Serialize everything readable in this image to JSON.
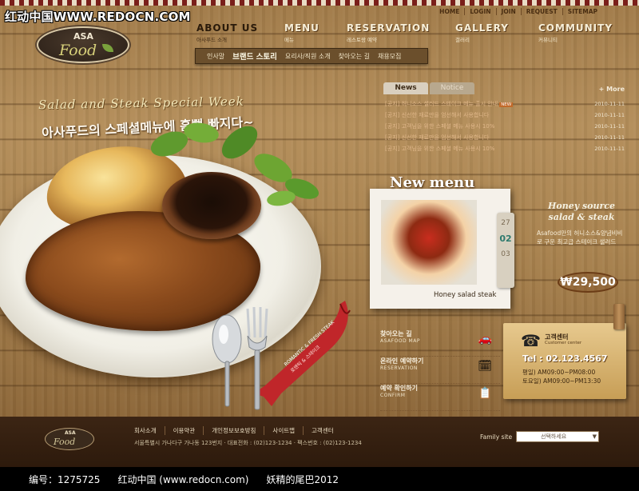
{
  "watermark": {
    "text": "红动中国WWW.REDOCN.COM"
  },
  "util_nav": [
    "HOME",
    "LOGIN",
    "JOIN",
    "REQUEST",
    "SITEMAP"
  ],
  "logo": {
    "top": "ASA",
    "main": "Food"
  },
  "nav": [
    {
      "label": "ABOUT US",
      "sub": "아사푸드 소개"
    },
    {
      "label": "MENU",
      "sub": "메뉴"
    },
    {
      "label": "RESERVATION",
      "sub": "레스토랑 예약"
    },
    {
      "label": "GALLERY",
      "sub": "갤러리"
    },
    {
      "label": "COMMUNITY",
      "sub": "커뮤니티"
    }
  ],
  "subnav": [
    "인사말",
    "브랜드 스토리",
    "요리사/직원 소개",
    "찾아오는 길",
    "채용모집"
  ],
  "hero": {
    "line1": "Salad and Steak Special Week",
    "line2": "아사푸드의 스페셜메뉴에 흠뻑 빠지다~"
  },
  "news": {
    "tab_news": "News",
    "tab_notice": "Notice",
    "more": "+ More",
    "items": [
      {
        "title": "[공지] 허니소스 샐러드 스테이크 메뉴 출시 안내",
        "date": "2010-11-11",
        "badge": "NEW"
      },
      {
        "title": "[공지] 신선한 재료만을 엄선해서 사용합니다",
        "date": "2010-11-11",
        "badge": ""
      },
      {
        "title": "[공지] 고객님을 위한 스페셜 메뉴 사용시 10%",
        "date": "2010-11-11",
        "badge": ""
      },
      {
        "title": "[공지] 신선한 재료만을 엄선해서 사용합니다",
        "date": "2010-11-11",
        "badge": ""
      },
      {
        "title": "[공지] 고객님을 위한 스페셜 메뉴 사용시 10%",
        "date": "2010-11-11",
        "badge": ""
      }
    ]
  },
  "new_menu": {
    "title": "New menu",
    "caption": "Honey salad steak",
    "tag": [
      "27",
      "02",
      "03"
    ],
    "name1": "Honey source",
    "name2": "salad & steak",
    "desc": "Asafood만의 허니소스&양념비비로 구운 최고급 스테이크 샐러드",
    "price": "₩29,500"
  },
  "ribbon": {
    "line1": "ROMANTIC & FRESH STEAK",
    "line2": "로맨틱 & 스테이크"
  },
  "links": [
    {
      "ko": "찾아오는 길",
      "en": "ASAFOOD MAP",
      "icon": "car-icon"
    },
    {
      "ko": "온라인 예약하기",
      "en": "RESERVATION",
      "icon": "calendar-icon"
    },
    {
      "ko": "예약 확인하기",
      "en": "CONFIRM",
      "icon": "note-icon"
    }
  ],
  "cs": {
    "label": "고객센터",
    "sub": "Customer center",
    "tel": "Tel : 02.123.4567",
    "hours1": "평일) AM09:00~PM08:00",
    "hours2": "토요일) AM09:00~PM13:30"
  },
  "footer": {
    "logo_top": "ASA",
    "logo_main": "Food",
    "links": [
      "회사소개",
      "이용약관",
      "개인정보보호방침",
      "사이트맵",
      "고객센터"
    ],
    "address": "서울특별시 가나다구 가나동 123번지 · 대표전화 : (02)123-1234 · 팩스번호 : (02)123-1234",
    "family_label": "Family site",
    "family_value": "선택하세요"
  },
  "caption": {
    "id": "编号：1275725",
    "site": "红动中国 (www.redocn.com)",
    "author": "妖精的尾巴2012"
  },
  "colors": {
    "wood": "#a8824e",
    "footer": "#2d1a0c",
    "accent_red": "#c0262a"
  }
}
